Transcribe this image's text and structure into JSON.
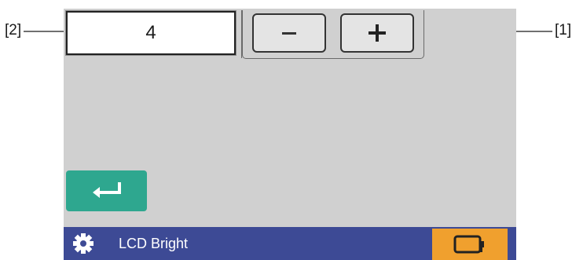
{
  "callouts": {
    "left": "[2]",
    "right": "[1]"
  },
  "value_field": {
    "value": "4"
  },
  "stepper": {
    "decrement_icon": "minus-icon",
    "increment_icon": "plus-icon"
  },
  "enter_button": {
    "icon": "enter-return-icon",
    "color": "#2ea78f"
  },
  "footer": {
    "title": "LCD Bright",
    "icon": "gear-icon",
    "bar_color": "#3d4a95",
    "battery_icon": "battery-icon",
    "battery_button_color": "#f0a02e"
  },
  "screen_color": "#d0d0d0"
}
